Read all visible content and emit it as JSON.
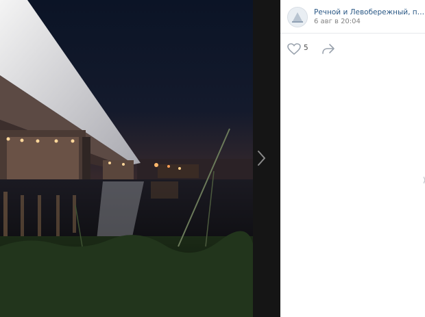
{
  "post": {
    "author": "Речной и Левобережный, привива...",
    "date": "6 авг в 20:04",
    "likes_count": "5",
    "avatar_icon": "river-station-icon",
    "like_icon": "heart-icon",
    "share_icon": "share-arrow-icon"
  },
  "viewer": {
    "next_icon": "chevron-right-icon",
    "photo_subject": "illuminated bridge over river at night"
  },
  "colors": {
    "link": "#2a5885",
    "muted": "#828282",
    "icon": "#99a2ad"
  }
}
